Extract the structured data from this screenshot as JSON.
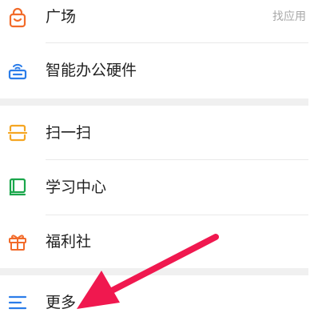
{
  "menu": {
    "items": [
      {
        "id": "square",
        "label": "广场",
        "hint": "找应用",
        "icon": "shopping-bag-icon",
        "color": "#f26b2a"
      },
      {
        "id": "smart-office-hardware",
        "label": "智能办公硬件",
        "icon": "router-icon",
        "color": "#2b7de9"
      },
      {
        "id": "scan",
        "label": "扫一扫",
        "icon": "scan-icon",
        "color": "#f5a623"
      },
      {
        "id": "learning-center",
        "label": "学习中心",
        "icon": "book-icon",
        "color": "#1aa64b"
      },
      {
        "id": "welfare",
        "label": "福利社",
        "icon": "gift-icon",
        "color": "#f26b2a"
      },
      {
        "id": "more",
        "label": "更多",
        "icon": "menu-lines-icon",
        "color": "#2b7de9"
      }
    ]
  },
  "annotation": {
    "icon": "red-arrow-icon",
    "color": "#f0184f"
  }
}
